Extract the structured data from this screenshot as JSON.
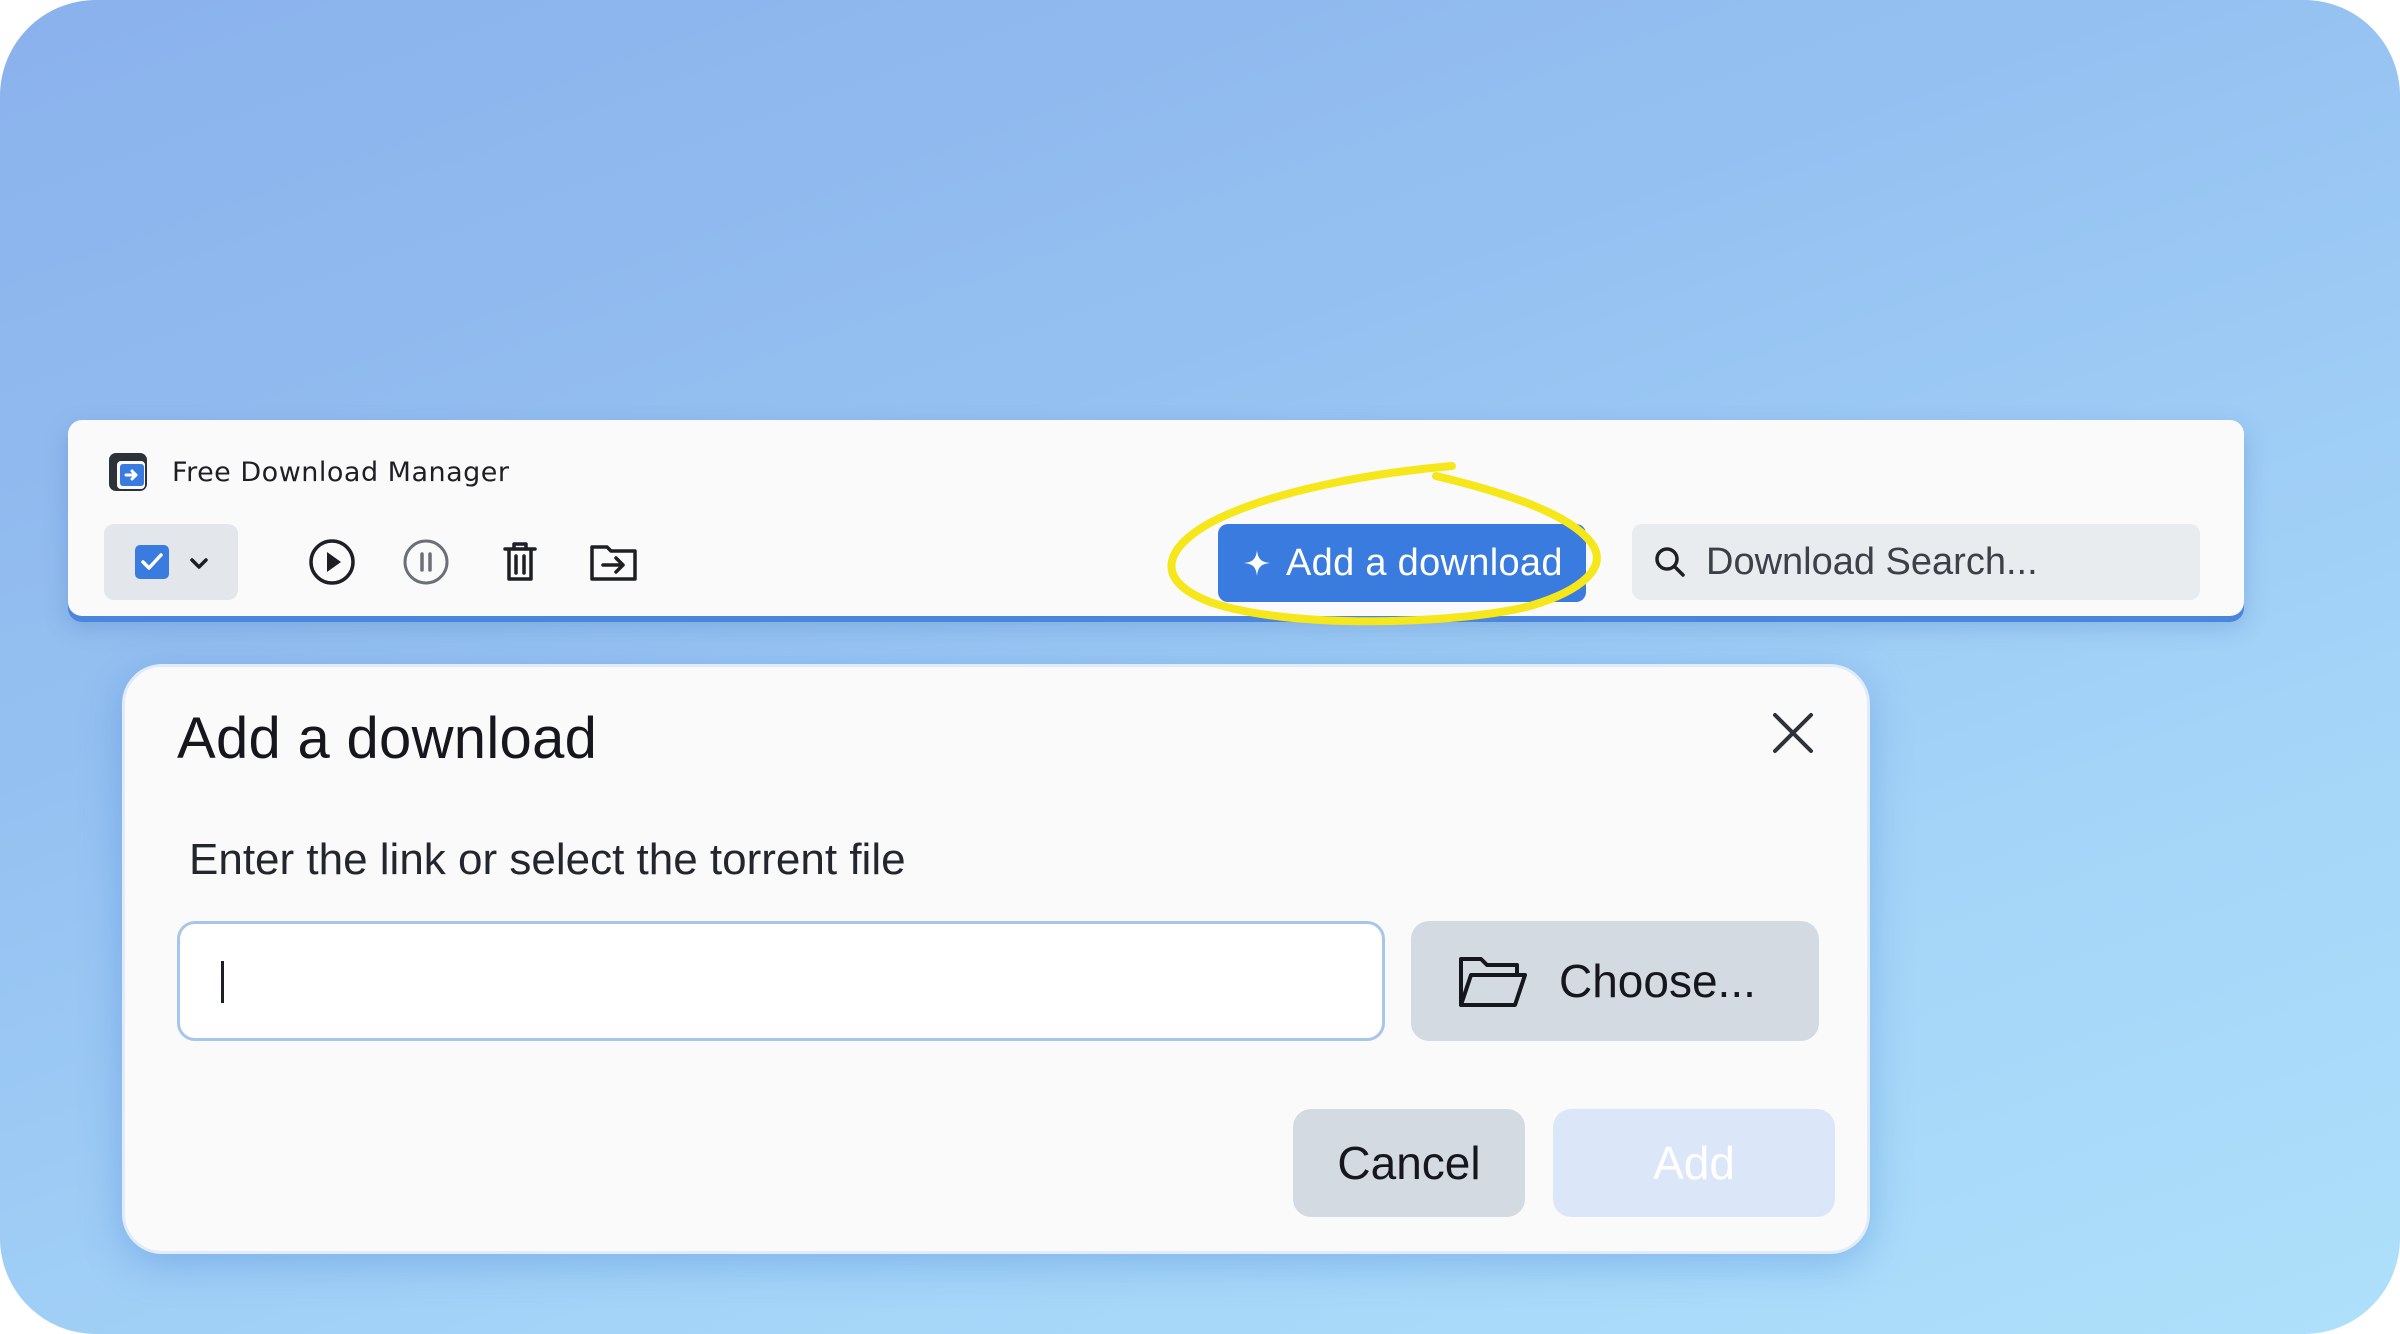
{
  "app": {
    "title": "Free Download Manager",
    "logo_icon": "fdm-logo-icon"
  },
  "toolbar": {
    "select_all_icon": "checkbox-checked-icon",
    "select_menu_icon": "chevron-down-icon",
    "start_icon": "play-icon",
    "pause_icon": "pause-icon",
    "delete_icon": "trash-icon",
    "move_icon": "move-to-folder-icon",
    "add_download_label": "Add a download",
    "add_download_icon": "sparkle-icon"
  },
  "search": {
    "placeholder": "Download Search...",
    "icon": "search-icon"
  },
  "dialog": {
    "title": "Add a download",
    "field_label": "Enter the link or select the torrent file",
    "link_value": "",
    "choose_label": "Choose...",
    "choose_icon": "folder-open-icon",
    "cancel_label": "Cancel",
    "add_label": "Add",
    "close_icon": "close-icon"
  },
  "colors": {
    "accent": "#3a7be0",
    "highlight": "#f5e71a",
    "background_top": "#8ab1ec",
    "background_bottom": "#aee0fb",
    "secondary_button": "#d3dae2",
    "disabled_button": "#dbe7f8"
  }
}
